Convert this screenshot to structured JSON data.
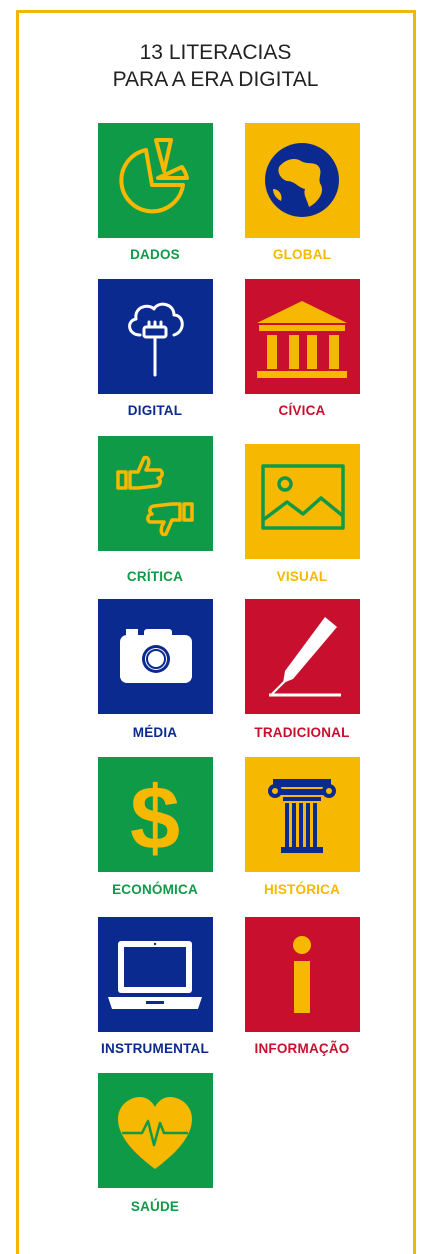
{
  "title": {
    "line1": "13 LITERACIAS",
    "line2": "PARA A ERA DIGITAL"
  },
  "colors": {
    "green": "#0f9a48",
    "yellow": "#f6b800",
    "blue": "#0b2a8f",
    "red": "#c8102e",
    "frame": "#f2b705"
  },
  "literacies": [
    {
      "label": "DADOS",
      "icon": "pie-chart-icon",
      "color": "green"
    },
    {
      "label": "GLOBAL",
      "icon": "globe-icon",
      "color": "yellow"
    },
    {
      "label": "DIGITAL",
      "icon": "cloud-plug-icon",
      "color": "blue"
    },
    {
      "label": "CÍVICA",
      "icon": "government-building-icon",
      "color": "red"
    },
    {
      "label": "CRÍTICA",
      "icon": "thumbs-up-down-icon",
      "color": "green"
    },
    {
      "label": "VISUAL",
      "icon": "image-icon",
      "color": "yellow"
    },
    {
      "label": "MÉDIA",
      "icon": "camera-icon",
      "color": "blue"
    },
    {
      "label": "TRADICIONAL",
      "icon": "pen-icon",
      "color": "red"
    },
    {
      "label": "ECONÓMICA",
      "icon": "dollar-icon",
      "color": "green"
    },
    {
      "label": "HISTÓRICA",
      "icon": "column-icon",
      "color": "yellow"
    },
    {
      "label": "INSTRUMENTAL",
      "icon": "laptop-icon",
      "color": "blue"
    },
    {
      "label": "INFORMAÇÃO",
      "icon": "info-icon",
      "color": "red"
    },
    {
      "label": "SAÚDE",
      "icon": "heart-pulse-icon",
      "color": "green"
    }
  ]
}
